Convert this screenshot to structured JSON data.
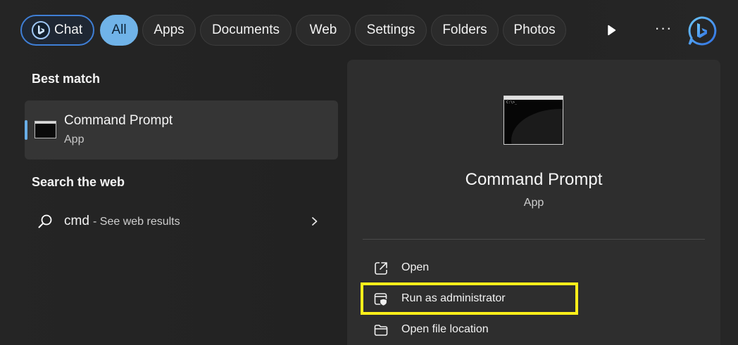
{
  "filters": {
    "chat": "Chat",
    "all": "All",
    "apps": "Apps",
    "documents": "Documents",
    "web": "Web",
    "settings": "Settings",
    "folders": "Folders",
    "photos": "Photos",
    "more": "···"
  },
  "left": {
    "best_match_title": "Best match",
    "best_match": {
      "name": "Command Prompt",
      "type": "App"
    },
    "search_web_title": "Search the web",
    "web_result": {
      "query": "cmd",
      "hint": "- See web results"
    }
  },
  "preview": {
    "name": "Command Prompt",
    "type": "App",
    "thumb_text": "C:\\>_",
    "actions": {
      "open": "Open",
      "run_admin": "Run as administrator",
      "open_location": "Open file location"
    }
  },
  "colors": {
    "accent": "#70b3e8",
    "highlight": "#ffef1a",
    "panel": "#2e2e2e",
    "selected_card": "#353535"
  },
  "icons": [
    "bing-chat-icon",
    "play-icon",
    "more-icon",
    "bing-icon",
    "search-icon",
    "chevron-right-icon",
    "open-external-icon",
    "shield-admin-icon",
    "folder-icon"
  ]
}
